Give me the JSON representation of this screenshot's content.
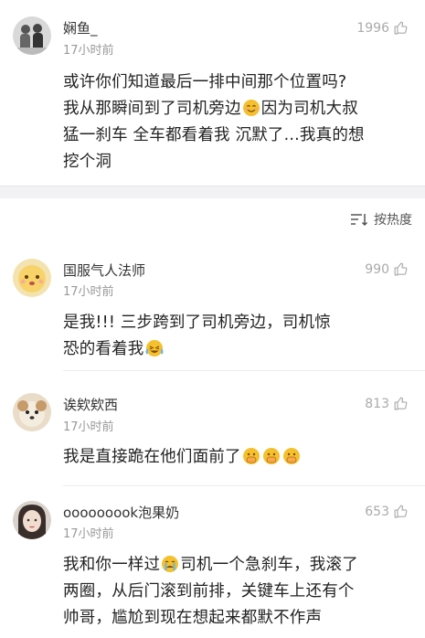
{
  "comments": [
    {
      "username": "娴鱼_",
      "time": "17小时前",
      "likes": "1996",
      "lines": [
        "或许你们知道最后一排中间那个位置吗?",
        "我从那瞬间到了司机旁边",
        "因为司机大叔",
        "猛一刹车 全车都看着我 沉默了...我真的想",
        "挖个洞"
      ]
    },
    {
      "username": "国服气人法师",
      "time": "17小时前",
      "likes": "990",
      "lines": [
        "是我!!! 三步跨到了司机旁边，司机惊",
        "恐的看着我"
      ]
    },
    {
      "username": "诶欸欸西",
      "time": "17小时前",
      "likes": "813",
      "lines": [
        "我是直接跪在他们面前了"
      ]
    },
    {
      "username": "ooooooook泡果奶",
      "time": "17小时前",
      "likes": "653",
      "lines": [
        "我和你一样过",
        "司机一个急刹车，我滚了",
        "两圈，从后门滚到前排，关键车上还有个",
        "帅哥，尴尬到现在想起来都默不作声"
      ]
    }
  ],
  "sort": {
    "label": "按热度",
    "icon": "sort-icon"
  },
  "icons": {
    "like": "thumbs-up-icon",
    "emoji_smile": "smile-emoji-icon",
    "emoji_laugh": "laugh-cry-emoji-icon",
    "emoji_clap": "clap-emoji-icon",
    "emoji_cry": "crying-emoji-icon"
  },
  "colors": {
    "text": "#222222",
    "meta": "#999999",
    "divider": "#f2f2f4",
    "emoji": "#f5c02e"
  }
}
